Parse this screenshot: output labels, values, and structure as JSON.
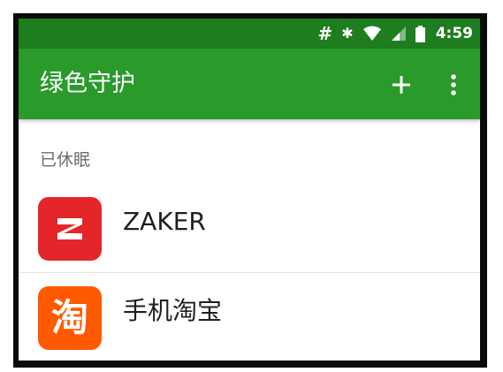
{
  "status_bar": {
    "hash_symbol": "#",
    "bluetooth_symbol": "✱",
    "time": "4:59"
  },
  "app_bar": {
    "title": "绿色守护",
    "add_symbol": "+",
    "more_symbol": "⋮",
    "background": "#2a9a2b",
    "status_background": "#1e7d1f"
  },
  "section": {
    "header": "已休眠"
  },
  "apps": [
    {
      "name": "ZAKER",
      "icon": "zaker-icon",
      "icon_color": "#e4262b"
    },
    {
      "name": "手机淘宝",
      "icon": "taobao-icon",
      "icon_glyph": "淘",
      "icon_color": "#ff5a00"
    }
  ]
}
